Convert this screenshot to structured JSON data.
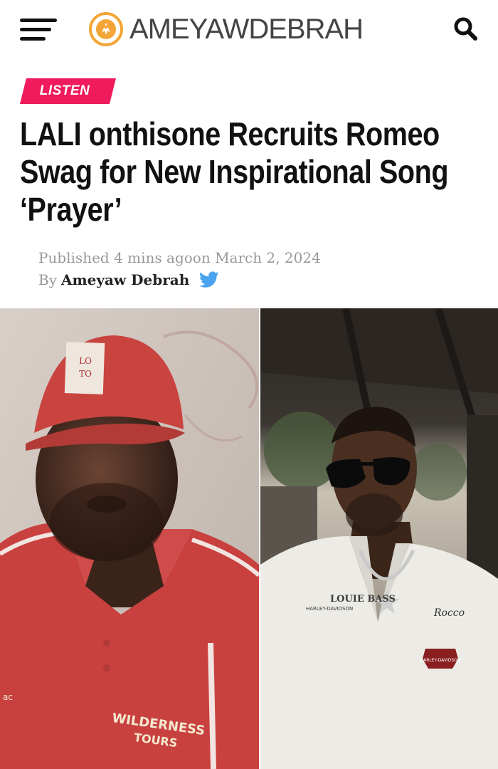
{
  "header": {
    "site_name": "AMEYAWDEBRAH",
    "menu_icon": "hamburger-menu-icon",
    "logo_icon": "ameyawdebrah-logo-icon",
    "search_icon": "search-icon",
    "logo_accent": "#f3a536"
  },
  "article": {
    "category": "LISTEN",
    "category_color": "#ef1b5c",
    "title": "LALI onthisone Recruits Romeo Swag for New Inspirational Song ‘Prayer’",
    "published_label": "Published",
    "published_ago": "4 mins ago",
    "published_on": "on March 2, 2024",
    "by_label": "By",
    "author": "Ameyaw Debrah",
    "twitter_icon": "twitter-icon",
    "twitter_color": "#4aa3ee"
  },
  "images": {
    "left": {
      "cap_text": "LO TO",
      "shirt_text_1": "WILDERNESS",
      "shirt_text_2": "TOURS",
      "sleeve_text": "ac"
    },
    "right": {
      "shirt_text_1": "LOUIE BASS",
      "shirt_text_2": "HARLEY-DAVIDSON",
      "name_tag": "Rocco",
      "patch_text": "HARLEY-DAVIDSON"
    }
  }
}
